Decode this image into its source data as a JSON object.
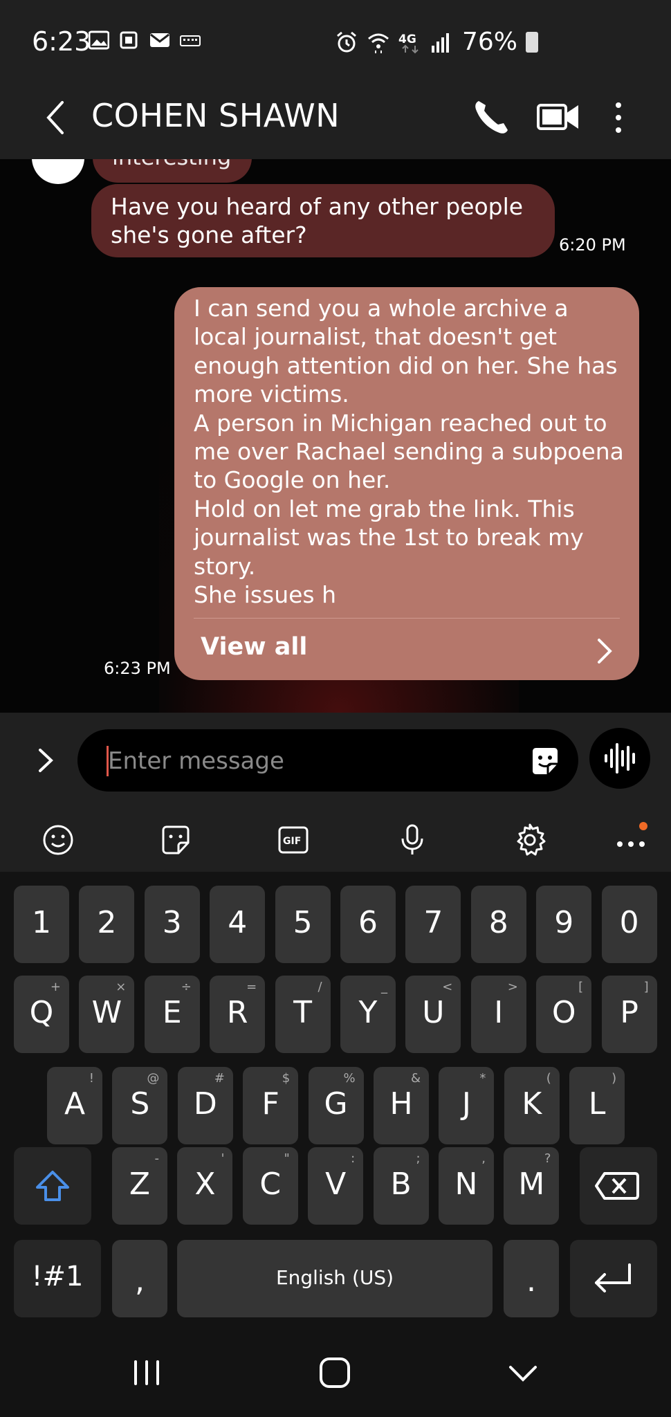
{
  "status_bar": {
    "time": "6:23",
    "network": "4G",
    "battery": "76%",
    "left_icons": [
      "gallery-icon",
      "calendar-icon",
      "email-icon",
      "keyboard-icon"
    ],
    "right_icons": [
      "alarm-icon",
      "wifi-icon",
      "4g-data-icon",
      "signal-icon",
      "battery-icon"
    ]
  },
  "header": {
    "contact_name": "COHEN SHAWN"
  },
  "messages": [
    {
      "direction": "incoming",
      "text": "interesting",
      "partial": true
    },
    {
      "direction": "incoming",
      "text": "Have you heard of any other people she's gone after?",
      "time": "6:20 PM"
    },
    {
      "direction": "outgoing",
      "text": "I can send you a whole archive a local journalist, that doesn't get enough attention did on her. She has more victims.\nA person in Michigan reached out to me over Rachael sending a subpoena to Google on her.\nHold on let me grab the link. This journalist was the 1st to break my story.\nShe issues h",
      "view_all": "View all",
      "time": "6:23 PM"
    }
  ],
  "composer": {
    "placeholder": "Enter message"
  },
  "keyboard": {
    "row_numbers": [
      "1",
      "2",
      "3",
      "4",
      "5",
      "6",
      "7",
      "8",
      "9",
      "0"
    ],
    "row_q": [
      {
        "k": "Q",
        "s": "+"
      },
      {
        "k": "W",
        "s": "×"
      },
      {
        "k": "E",
        "s": "÷"
      },
      {
        "k": "R",
        "s": "="
      },
      {
        "k": "T",
        "s": "/"
      },
      {
        "k": "Y",
        "s": "_"
      },
      {
        "k": "U",
        "s": "<"
      },
      {
        "k": "I",
        "s": ">"
      },
      {
        "k": "O",
        "s": "["
      },
      {
        "k": "P",
        "s": "]"
      }
    ],
    "row_a": [
      {
        "k": "A",
        "s": "!"
      },
      {
        "k": "S",
        "s": "@"
      },
      {
        "k": "D",
        "s": "#"
      },
      {
        "k": "F",
        "s": "$"
      },
      {
        "k": "G",
        "s": "%"
      },
      {
        "k": "H",
        "s": "&"
      },
      {
        "k": "J",
        "s": "*"
      },
      {
        "k": "K",
        "s": "("
      },
      {
        "k": "L",
        "s": ")"
      }
    ],
    "row_z": [
      {
        "k": "Z",
        "s": "-"
      },
      {
        "k": "X",
        "s": "'"
      },
      {
        "k": "C",
        "s": "\""
      },
      {
        "k": "V",
        "s": ":"
      },
      {
        "k": "B",
        "s": ";"
      },
      {
        "k": "N",
        "s": ","
      },
      {
        "k": "M",
        "s": "?"
      }
    ],
    "symbols_key": "!#1",
    "comma_key": ",",
    "space_label": "English (US)",
    "period_key": "."
  },
  "colors": {
    "incoming_bubble": "#5a2626",
    "outgoing_bubble": "#b5776b",
    "bars": "#202020",
    "key": "#353535",
    "shift_accent": "#4a8fe8",
    "notification_dot": "#f06a26",
    "caret": "#e0574a"
  }
}
